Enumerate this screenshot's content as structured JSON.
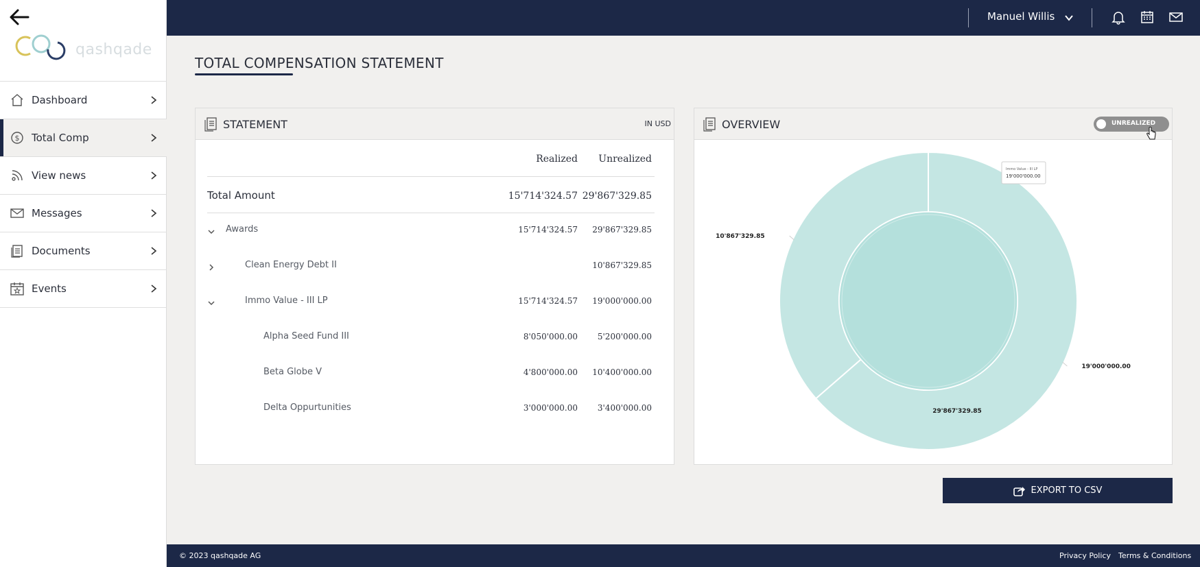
{
  "sidebar": {
    "logo_text": "qashqade",
    "items": [
      {
        "label": "Dashboard",
        "icon": "home-icon"
      },
      {
        "label": "Total Comp",
        "icon": "dollar-circle-icon",
        "active": true
      },
      {
        "label": "View news",
        "icon": "news-feed-icon"
      },
      {
        "label": "Messages",
        "icon": "envelope-icon"
      },
      {
        "label": "Documents",
        "icon": "documents-icon"
      },
      {
        "label": "Events",
        "icon": "calendar-star-icon"
      }
    ]
  },
  "topbar": {
    "user_name": "Manuel Willis",
    "icons": [
      "bell-icon",
      "calendar-icon",
      "mail-icon"
    ]
  },
  "page": {
    "title": "TOTAL COMPENSATION STATEMENT"
  },
  "statement": {
    "title": "STATEMENT",
    "currency_note": "IN USD",
    "columns": [
      "Realized",
      "Unrealized"
    ],
    "total": {
      "label": "Total Amount",
      "realized": "15'714'324.57",
      "unrealized": "29'867'329.85"
    },
    "rows": [
      {
        "label": "Awards",
        "realized": "15'714'324.57",
        "unrealized": "29'867'329.85",
        "expander": "expanded"
      },
      {
        "label": "Clean Energy Debt II",
        "realized": "",
        "unrealized": "10'867'329.85",
        "expander": "collapsed"
      },
      {
        "label": "Immo Value - III LP",
        "realized": "15'714'324.57",
        "unrealized": "19'000'000.00",
        "expander": "expanded"
      },
      {
        "label": "Alpha Seed Fund III",
        "realized": "8'050'000.00",
        "unrealized": "5'200'000.00"
      },
      {
        "label": "Beta Globe V",
        "realized": "4'800'000.00",
        "unrealized": "10'400'000.00"
      },
      {
        "label": "Delta Oppurtunities",
        "realized": "3'000'000.00",
        "unrealized": "3'400'000.00"
      }
    ]
  },
  "overview": {
    "title": "OVERVIEW",
    "toggle_label": "UNREALIZED",
    "toggle_on": false,
    "tooltip": {
      "label": "Immo Value - III LP",
      "value": "19'000'000.00"
    }
  },
  "chart_data": {
    "type": "pie",
    "subtype": "sunburst",
    "inner": [
      {
        "label": "29'867'329.85",
        "value": 29867329.85
      }
    ],
    "outer": [
      {
        "label": "10'867'329.85",
        "value": 10867329.85
      },
      {
        "label": "19'000'000.00",
        "value": 19000000.0
      }
    ],
    "colors": {
      "outer": "#c4e6e3",
      "inner": "#b4e0dc",
      "separator": "#ffffff"
    }
  },
  "export": {
    "label": "EXPORT TO CSV"
  },
  "footer": {
    "copyright": "© 2023 qashqade AG",
    "links": [
      "Privacy Policy",
      "Terms & Conditions"
    ]
  },
  "colors": {
    "navy": "#1c2847",
    "background": "#f1f0ee",
    "accent_teal": "#c4e6e3"
  }
}
